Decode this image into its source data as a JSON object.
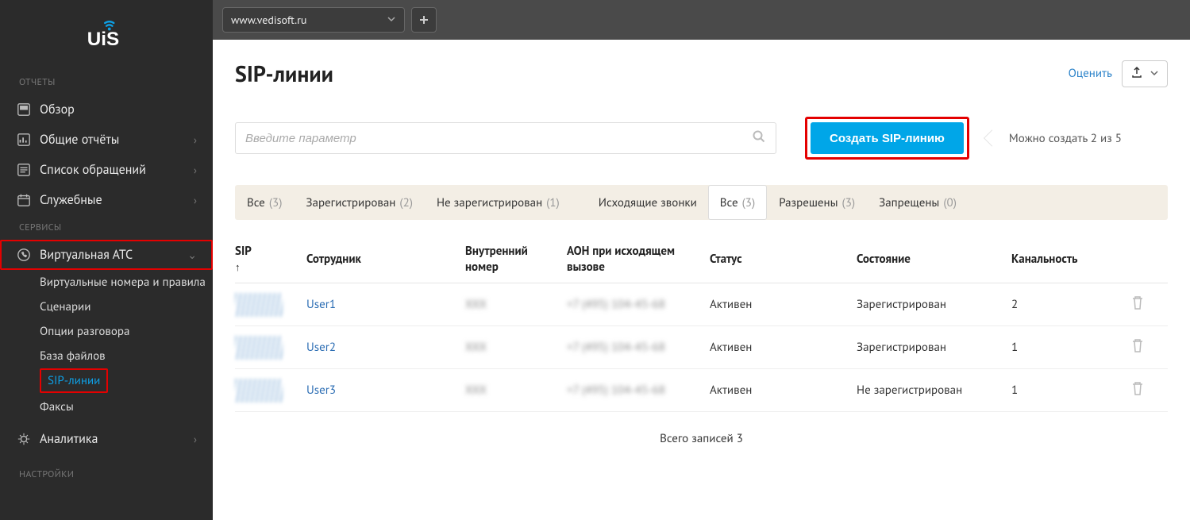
{
  "sidebar": {
    "section_reports": "ОТЧЕТЫ",
    "section_services": "СЕРВИСЫ",
    "section_settings": "НАСТРОЙКИ",
    "items": {
      "overview": "Обзор",
      "general_reports": "Общие отчёты",
      "requests": "Список обращений",
      "service_reports": "Служебные",
      "virtual_pbx": "Виртуальная АТС",
      "analytics": "Аналитика"
    },
    "subitems": {
      "virtual_numbers": "Виртуальные номера и правила",
      "scenarios": "Сценарии",
      "call_options": "Опции разговора",
      "file_db": "База файлов",
      "sip_lines": "SIP-линии",
      "faxes": "Факсы"
    }
  },
  "topbar": {
    "site": "www.vedisoft.ru"
  },
  "page": {
    "title": "SIP-линии",
    "rate": "Оценить",
    "search_placeholder": "Введите параметр",
    "create_btn": "Создать SIP-линию",
    "quota": "Можно создать 2 из 5"
  },
  "filters": {
    "all": "Все",
    "all_count": "(3)",
    "registered": "Зарегистрирован",
    "registered_count": "(2)",
    "not_registered": "Не зарегистрирован",
    "not_registered_count": "(1)",
    "outgoing_label": "Исходящие звонки",
    "all2": "Все",
    "all2_count": "(3)",
    "allowed": "Разрешены",
    "allowed_count": "(3)",
    "denied": "Запрещены",
    "denied_count": "(0)"
  },
  "columns": {
    "sip": "SIP",
    "employee": "Сотрудник",
    "internal": "Внутренний номер",
    "aon": "АОН при исходящем вызове",
    "status": "Статус",
    "state": "Состояние",
    "channels": "Каналь­ность"
  },
  "rows": [
    {
      "user": "User1",
      "internal": "XXX",
      "aon": "+7 (495) 104-45-68",
      "status": "Активен",
      "state": "Зарегистрирован",
      "channels": "2"
    },
    {
      "user": "User2",
      "internal": "XXX",
      "aon": "+7 (495) 104-45-68",
      "status": "Активен",
      "state": "Зарегистрирован",
      "channels": "1"
    },
    {
      "user": "User3",
      "internal": "XXX",
      "aon": "+7 (495) 104-45-68",
      "status": "Активен",
      "state": "Не зарегистрирован",
      "channels": "1"
    }
  ],
  "footer": {
    "total": "Всего записей 3"
  }
}
